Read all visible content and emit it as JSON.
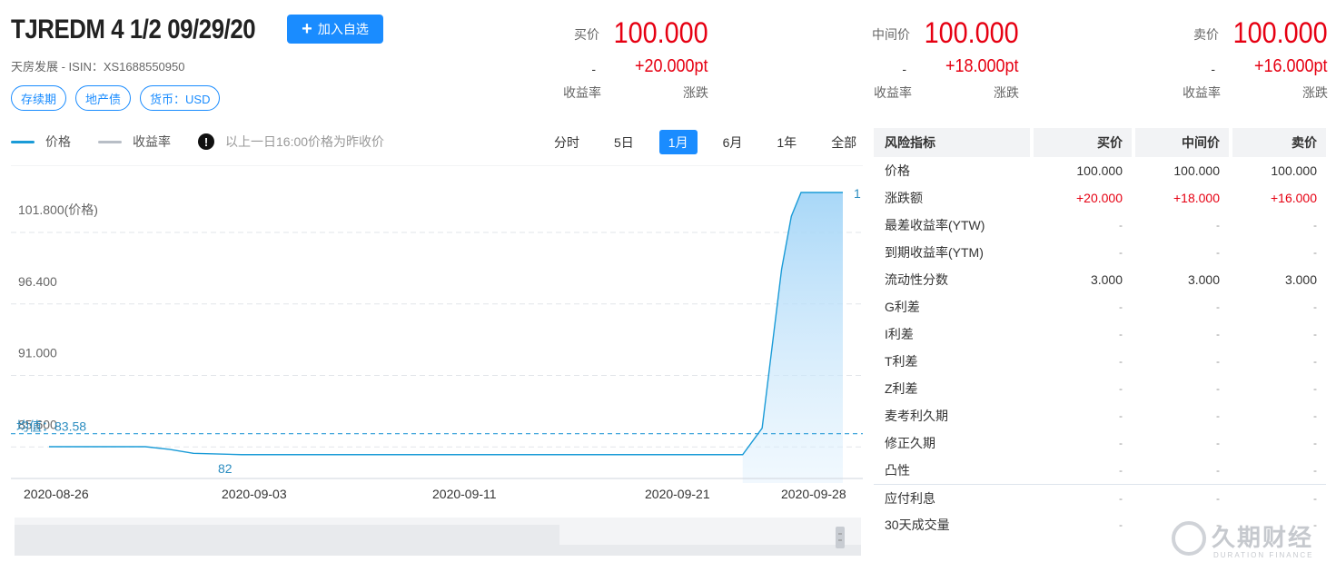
{
  "header": {
    "title": "TJREDM 4 1/2 09/29/20",
    "add_label": "加入自选",
    "subtitle": "天房发展 - ISIN：XS1688550950",
    "tags": [
      "存续期",
      "地产债",
      "货币：USD"
    ]
  },
  "quotes": [
    {
      "label": "买价",
      "price": "100.000",
      "yield": "-",
      "yield_label": "收益率",
      "change": "+20.000pt",
      "change_label": "涨跌"
    },
    {
      "label": "中间价",
      "price": "100.000",
      "yield": "-",
      "yield_label": "收益率",
      "change": "+18.000pt",
      "change_label": "涨跌"
    },
    {
      "label": "卖价",
      "price": "100.000",
      "yield": "-",
      "yield_label": "收益率",
      "change": "+16.000pt",
      "change_label": "涨跌"
    }
  ],
  "legend": {
    "price": "价格",
    "yield": "收益率",
    "note": "以上一日16:00价格为昨收价"
  },
  "periods": [
    {
      "label": "分时",
      "active": false
    },
    {
      "label": "5日",
      "active": false
    },
    {
      "label": "1月",
      "active": true
    },
    {
      "label": "6月",
      "active": false
    },
    {
      "label": "1年",
      "active": false
    },
    {
      "label": "全部",
      "active": false
    }
  ],
  "chart_data": {
    "type": "area",
    "y_tick_labels": [
      "101.800(价格)",
      "96.400",
      "91.000",
      "85.600"
    ],
    "y_ticks": [
      101.8,
      96.4,
      91.0,
      85.6
    ],
    "ylim": [
      80.2,
      101.8
    ],
    "x_tick_labels": [
      "2020-08-26",
      "2020-09-03",
      "2020-09-11",
      "2020-09-21",
      "2020-09-28"
    ],
    "avg_label": "均值：83.58",
    "avg_value": 83.58,
    "min_label": "82",
    "max_label": "1",
    "series": [
      {
        "name": "价格",
        "points": [
          [
            "2020-08-26",
            82.6
          ],
          [
            "2020-08-28",
            82.6
          ],
          [
            "2020-08-30",
            82.6
          ],
          [
            "2020-08-31",
            82.4
          ],
          [
            "2020-09-01",
            82.1
          ],
          [
            "2020-09-03",
            82.0
          ],
          [
            "2020-09-11",
            82.0
          ],
          [
            "2020-09-21",
            82.0
          ],
          [
            "2020-09-25",
            82.0
          ],
          [
            "2020-09-26",
            84.0
          ],
          [
            "2020-09-26.5",
            90.0
          ],
          [
            "2020-09-27",
            96.0
          ],
          [
            "2020-09-27.5",
            100.0
          ],
          [
            "2020-09-28",
            101.8
          ],
          [
            "2020-09-29",
            101.8
          ]
        ]
      }
    ],
    "grid": true,
    "color": "#1a9bd7"
  },
  "risk_table": {
    "headers": [
      "风险指标",
      "买价",
      "中间价",
      "卖价"
    ],
    "rows": [
      {
        "label": "价格",
        "values": [
          "100.000",
          "100.000",
          "100.000"
        ],
        "style": "num"
      },
      {
        "label": "涨跌额",
        "values": [
          "+20.000",
          "+18.000",
          "+16.000"
        ],
        "style": "red"
      },
      {
        "label": "最差收益率(YTW)",
        "values": [
          "-",
          "-",
          "-"
        ],
        "style": "dash"
      },
      {
        "label": "到期收益率(YTM)",
        "values": [
          "-",
          "-",
          "-"
        ],
        "style": "dash"
      },
      {
        "label": "流动性分数",
        "values": [
          "3.000",
          "3.000",
          "3.000"
        ],
        "style": "num"
      },
      {
        "label": "G利差",
        "values": [
          "-",
          "-",
          "-"
        ],
        "style": "dash"
      },
      {
        "label": "I利差",
        "values": [
          "-",
          "-",
          "-"
        ],
        "style": "dash"
      },
      {
        "label": "T利差",
        "values": [
          "-",
          "-",
          "-"
        ],
        "style": "dash"
      },
      {
        "label": "Z利差",
        "values": [
          "-",
          "-",
          "-"
        ],
        "style": "dash"
      },
      {
        "label": "麦考利久期",
        "values": [
          "-",
          "-",
          "-"
        ],
        "style": "dash"
      },
      {
        "label": "修正久期",
        "values": [
          "-",
          "-",
          "-"
        ],
        "style": "dash"
      },
      {
        "label": "凸性",
        "values": [
          "-",
          "-",
          "-"
        ],
        "style": "dash"
      },
      {
        "label": "应付利息",
        "values": [
          "-",
          "-",
          "-"
        ],
        "style": "dash",
        "sep": true
      },
      {
        "label": "30天成交量",
        "values": [
          "-",
          "-",
          "-"
        ],
        "style": "dash"
      }
    ]
  },
  "watermark": {
    "cn": "久期财经",
    "en": "DURATION FINANCE"
  },
  "colors": {
    "accent": "#1a8cff",
    "up": "#e60012",
    "line": "#1a9bd7"
  }
}
